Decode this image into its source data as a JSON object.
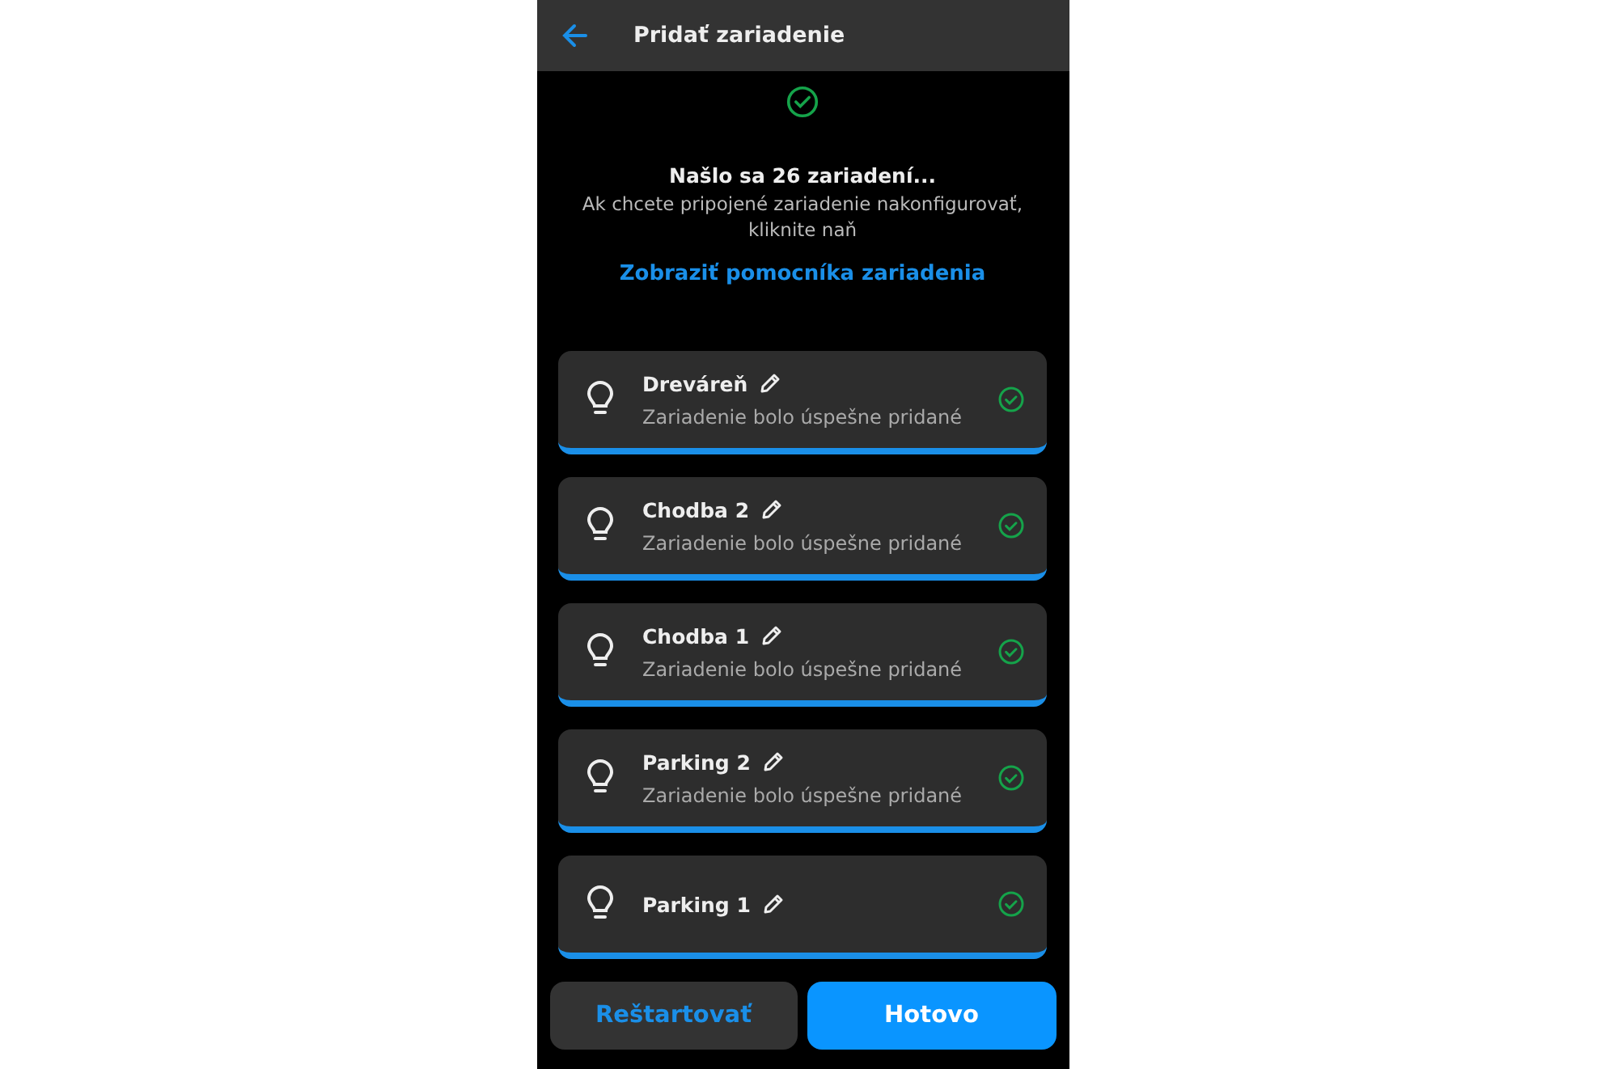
{
  "header": {
    "title": "Pridať zariadenie"
  },
  "result": {
    "headline": "Našlo sa 26 zariadení...",
    "hint": "Ak chcete pripojené zariadenie nakonfigurovať, kliknite naň",
    "link": "Zobraziť pomocníka zariadenia"
  },
  "devices": [
    {
      "name": "Dreváreň",
      "status": "Zariadenie bolo úspešne pridané",
      "added": true
    },
    {
      "name": "Chodba 2",
      "status": "Zariadenie bolo úspešne pridané",
      "added": true
    },
    {
      "name": "Chodba 1",
      "status": "Zariadenie bolo úspešne pridané",
      "added": true
    },
    {
      "name": "Parking 2",
      "status": "Zariadenie bolo úspešne pridané",
      "added": true
    },
    {
      "name": "Parking 1",
      "added": true
    }
  ],
  "buttons": [
    {
      "label": "Reštartovať",
      "kind": "secondary"
    },
    {
      "label": "Hotovo",
      "kind": "primary"
    }
  ]
}
